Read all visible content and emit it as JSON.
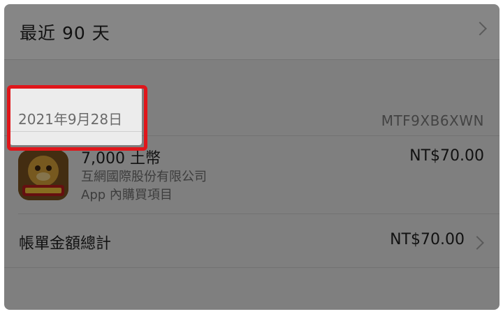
{
  "header": {
    "period_label": "最近 90 天"
  },
  "order": {
    "date": "2021年9月28日",
    "id": "MTF9XB6XWN"
  },
  "item": {
    "icon": "game-app-icon",
    "name": "7,000 土幣",
    "vendor": "互網國際股份有限公司",
    "type": "App 內購買項目",
    "price": "NT$70.00"
  },
  "total": {
    "label": "帳單金額總計",
    "amount": "NT$70.00"
  },
  "colors": {
    "highlight": "#e0161b",
    "overlay": "rgba(0,0,0,0.45)"
  }
}
